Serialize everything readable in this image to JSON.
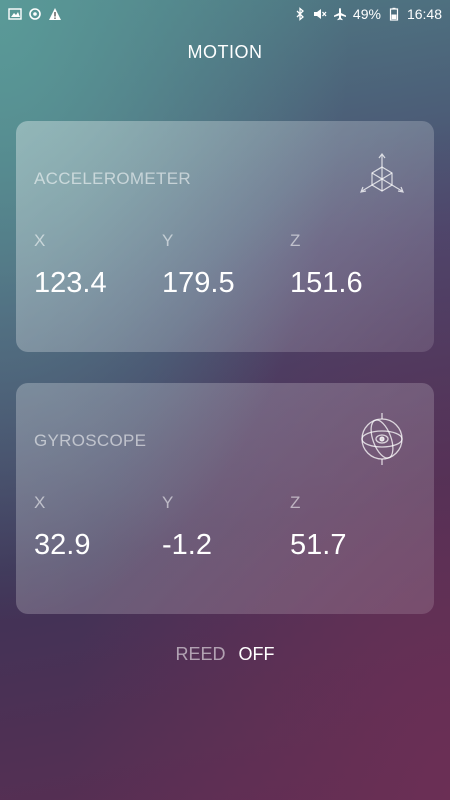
{
  "status_bar": {
    "left_icons": [
      "image-icon",
      "sync-icon",
      "warning-icon"
    ],
    "right_icons": [
      "bluetooth-icon",
      "mute-icon",
      "airplane-icon",
      "battery-icon"
    ],
    "battery": "49%",
    "time": "16:48"
  },
  "screen_title": "MOTION",
  "accelerometer": {
    "title": "ACCELEROMETER",
    "icon": "cube-axes-icon",
    "axes": [
      {
        "label": "X",
        "value": "123.4"
      },
      {
        "label": "Y",
        "value": "179.5"
      },
      {
        "label": "Z",
        "value": "151.6"
      }
    ]
  },
  "gyroscope": {
    "title": "GYROSCOPE",
    "icon": "gyroscope-icon",
    "axes": [
      {
        "label": "X",
        "value": "32.9"
      },
      {
        "label": "Y",
        "value": "-1.2"
      },
      {
        "label": "Z",
        "value": "51.7"
      }
    ]
  },
  "reed": {
    "label": "REED",
    "value": "OFF"
  },
  "colors": {
    "text_primary": "#ffffff",
    "text_muted": "#b9b6c8",
    "gradient_top": "#5a9a98",
    "gradient_bottom": "#6b2f55"
  }
}
